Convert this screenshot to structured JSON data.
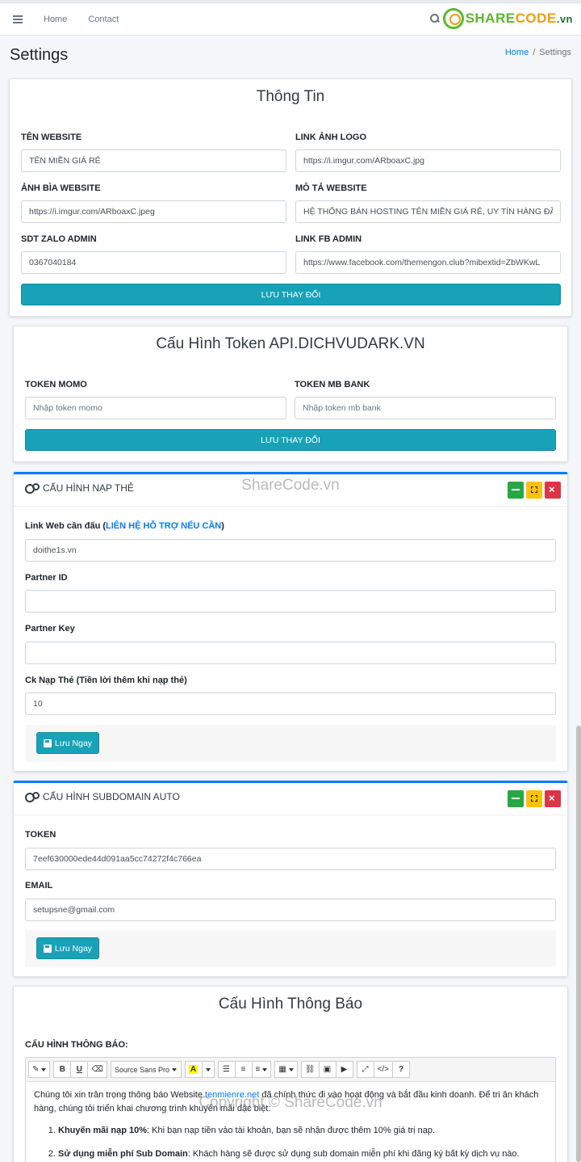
{
  "navbar": {
    "home": "Home",
    "contact": "Contact",
    "logo": {
      "part1": "SHARE",
      "part2": "CODE",
      "part3": ".vn"
    }
  },
  "header": {
    "title": "Settings",
    "breadcrumb": {
      "home": "Home",
      "separator": "/",
      "current": "Settings"
    }
  },
  "info_card": {
    "title": "Thông Tin",
    "fields": {
      "site_name": {
        "label": "Tên Website",
        "value": "TÊN MIỀN GIÁ RẺ"
      },
      "logo": {
        "label": "Link Ảnh Logo",
        "value": "https://i.imgur.com/ARboaxC.jpg"
      },
      "cover": {
        "label": "Ảnh Bìa Website",
        "value": "https://i.imgur.com/ARboaxC.jpeg"
      },
      "description": {
        "label": "Mô Tả Website",
        "value": "HỆ THỐNG BÁN HOSTING TÊN MIỀN GIÁ RẺ, UY TÍN HÀNG ĐẦU VIỆT NAM"
      },
      "zalo": {
        "label": "SDT Zalo Admin",
        "value": "0367040184"
      },
      "fb": {
        "label": "Link FB Admin",
        "value": "https://www.facebook.com/themengon.club?mibextid=ZbWKwL"
      }
    },
    "save": "Lưu Thay Đổi"
  },
  "token_card": {
    "title": "Cấu Hình Token API.DICHVUDARK.VN",
    "momo": {
      "label": "Token Momo",
      "placeholder": "Nhập token momo"
    },
    "mb": {
      "label": "Token MB Bank",
      "placeholder": "Nhập token mb bank"
    },
    "save": "Lưu Thay Đổi"
  },
  "card_topup": {
    "title": "Cấu Hình Nạp Thẻ",
    "web": {
      "label_prefix": "Link Web cần đấu (",
      "label_link": "LIÊN HỆ HỖ TRỢ NẾU CẦN",
      "label_suffix": ")",
      "value": "doithe1s.vn"
    },
    "partner_id": {
      "label": "Partner ID",
      "value": ""
    },
    "partner_key": {
      "label": "Partner Key",
      "value": ""
    },
    "ck": {
      "label": "Ck Nạp Thẻ (Tiền lời thêm khi nạp thẻ)",
      "value": "10"
    },
    "save": "Lưu Ngay"
  },
  "subdomain_card": {
    "title": "Cấu Hình Subdomain Auto",
    "token": {
      "label": "Token",
      "value": "7eef630000ede44d091aa5cc74272f4c766ea"
    },
    "email": {
      "label": "Email",
      "value": "setupsne@gmail.com"
    },
    "save": "Lưu Ngay"
  },
  "notice_card": {
    "title": "Cấu Hình Thông Báo",
    "label": "Cấu Hình Thông Báo:",
    "toolbar": {
      "font": "Source Sans Pro",
      "highlight": "A",
      "help": "?"
    },
    "content": {
      "intro_before": "Chúng tôi xin trân trọng thông báo Website ",
      "intro_link": "tenmienre.net",
      "intro_after": " đã chính thức đi vào hoạt động và bắt đầu kinh doanh. Để tri ân khách hàng, chúng tôi triển khai chương trình khuyến mãi đặc biệt:",
      "items": [
        {
          "strong": "Khuyến mãi nạp 10%",
          "text": ": Khi bạn nạp tiền vào tài khoản, bạn sẽ nhận được thêm 10% giá trị nạp."
        },
        {
          "strong": "Sử dụng miễn phí Sub Domain",
          "text": ": Khách hàng sẽ được sử dụng sub domain miễn phí khi đăng ký bất kỳ dịch vụ nào."
        }
      ]
    }
  },
  "watermarks": {
    "top": "ShareCode.vn",
    "bottom": "Copyright © ShareCode.vn"
  },
  "colors": {
    "accent": "#17a2b8",
    "link": "#007bff",
    "green": "#28a745",
    "yellow": "#ffc107",
    "red": "#dc3545"
  }
}
